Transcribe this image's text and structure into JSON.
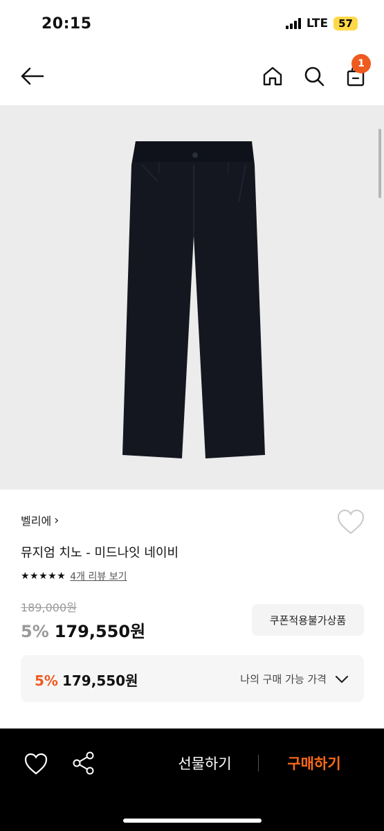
{
  "status_bar": {
    "time": "20:15",
    "network": "LTE",
    "battery": "57"
  },
  "header": {
    "cart_count": "1"
  },
  "product": {
    "brand": "벨리에",
    "brand_chevron": "›",
    "name": "뮤지엄 치노 - 미드나잇 네이비",
    "rating_stars": "★★★★★",
    "reviews_link": "4개 리뷰 보기",
    "original_price": "189,000원",
    "discount": "5%",
    "sale_price": "179,550원",
    "coupon_label": "쿠폰적용불가상품"
  },
  "my_price": {
    "discount": "5%",
    "price": "179,550원",
    "label": "나의 구매 가능 가격"
  },
  "bottom_bar": {
    "gift_label": "선물하기",
    "buy_label": "구매하기"
  },
  "colors": {
    "accent": "#ef5a1f",
    "buy_text": "#ff6a1a",
    "image_bg": "#ececec",
    "pants": "#14171f"
  },
  "icons": [
    "back-arrow-icon",
    "home-icon",
    "search-icon",
    "cart-icon",
    "heart-icon",
    "share-icon",
    "chevron-down-icon"
  ]
}
